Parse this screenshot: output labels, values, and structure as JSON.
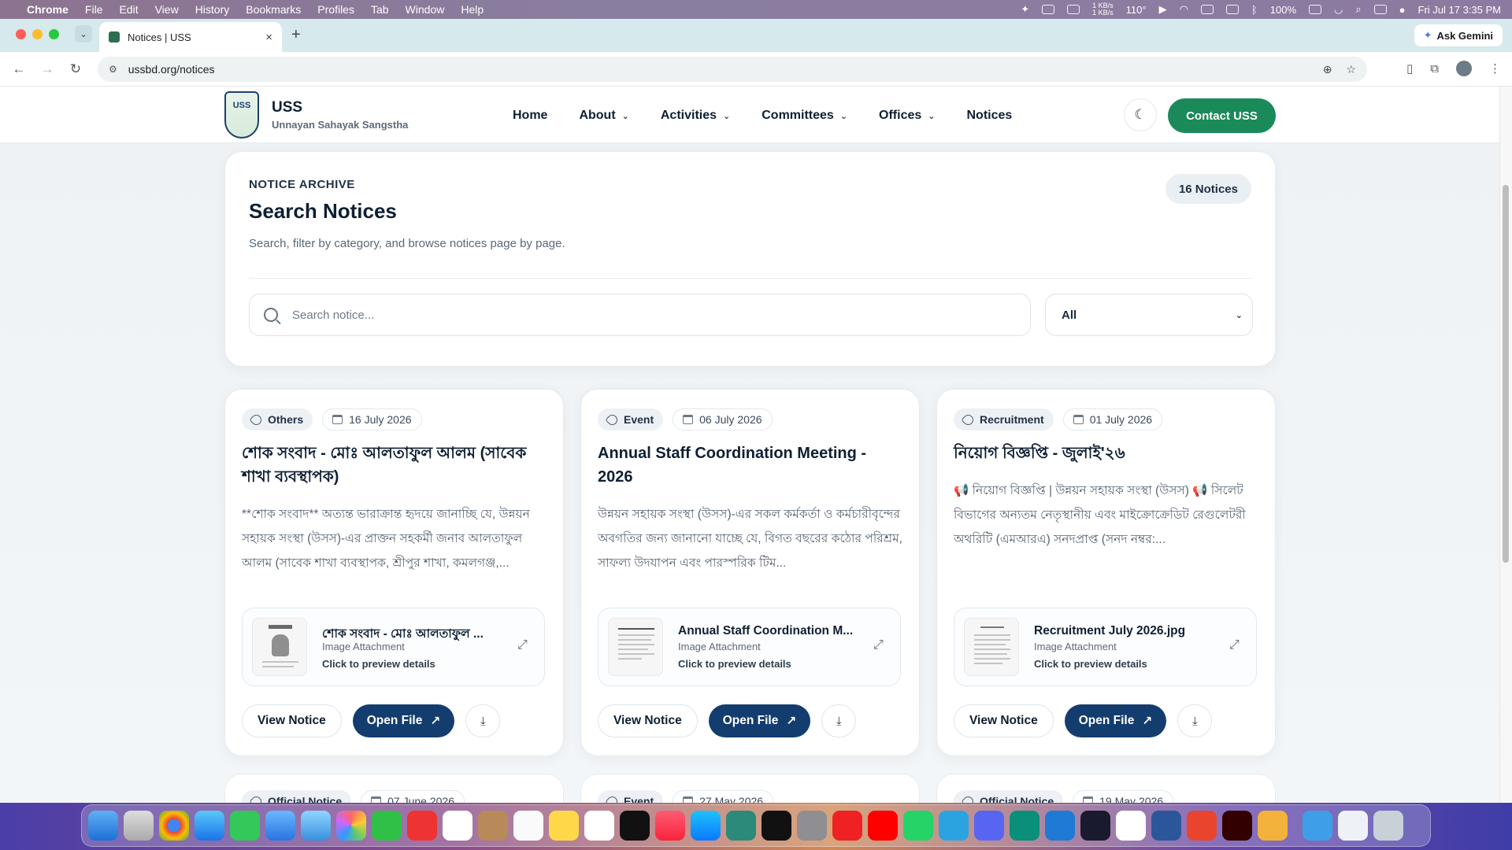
{
  "menubar": {
    "app": "Chrome",
    "items": [
      "File",
      "Edit",
      "View",
      "History",
      "Bookmarks",
      "Profiles",
      "Tab",
      "Window",
      "Help"
    ],
    "net_up": "1 KB/s",
    "net_down": "1 KB/s",
    "temp": "110°",
    "battery": "100%",
    "datetime": "Fri Jul 17  3:35 PM"
  },
  "browser": {
    "tab_title": "Notices | USS",
    "url": "ussbd.org/notices",
    "ask_gemini": "Ask Gemini"
  },
  "site": {
    "brand_name": "USS",
    "brand_sub": "Unnayan Sahayak Sangstha",
    "nav": [
      "Home",
      "About",
      "Activities",
      "Committees",
      "Offices",
      "Notices"
    ],
    "contact": "Contact USS"
  },
  "search": {
    "eyebrow": "NOTICE ARCHIVE",
    "title": "Search Notices",
    "description": "Search, filter by category, and browse notices page by page.",
    "count": "16 Notices",
    "placeholder": "Search notice...",
    "category": "All"
  },
  "notices": [
    {
      "category": "Others",
      "date": "16 July 2026",
      "title": "শোক সংবাদ - মোঃ আলতাফুল আলম (সাবেক শাখা ব্যবস্থাপক)",
      "excerpt": "**শোক সংবাদ** অত্যন্ত ভারাক্রান্ত হৃদয়ে জানাচ্ছি যে, উন্নয়ন সহায়ক সংস্থা (উসস)-এর প্রাক্তন সহকর্মী জনাব আলতাফুল আলম (সাবেক শাখা ব্যবস্থাপক, শ্রীপুর শাখা, কমলগঞ্জ,...",
      "attachment_name": "শোক সংবাদ - মোঃ আলতাফুল ...",
      "attachment_type": "Image Attachment",
      "attachment_hint": "Click to preview details"
    },
    {
      "category": "Event",
      "date": "06 July 2026",
      "title": "Annual Staff Coordination Meeting - 2026",
      "excerpt": "উন্নয়ন সহায়ক সংস্থা (উসস)-এর সকল কর্মকর্তা ও কর্মচারীবৃন্দের অবগতির জন্য জানানো যাচ্ছে যে, বিগত বছরের কঠোর পরিশ্রম, সাফল্য উদযাপন এবং পারস্পরিক টিম...",
      "attachment_name": "Annual Staff Coordination M...",
      "attachment_type": "Image Attachment",
      "attachment_hint": "Click to preview details"
    },
    {
      "category": "Recruitment",
      "date": "01 July 2026",
      "title": "নিয়োগ বিজ্ঞপ্তি - জুলাই'২৬",
      "excerpt": "📢 নিয়োগ বিজ্ঞপ্তি | উন্নয়ন সহায়ক সংস্থা (উসস) 📢 সিলেট বিভাগের অন্যতম নেতৃস্থানীয় এবং মাইক্রোক্রেডিট রেগুলেটরী অথরিটি (এমআরএ) সনদপ্রাপ্ত (সনদ নম্বর:...",
      "attachment_name": "Recruitment July 2026.jpg",
      "attachment_type": "Image Attachment",
      "attachment_hint": "Click to preview details"
    }
  ],
  "notices_next": [
    {
      "category": "Official Notice",
      "date": "07 June 2026"
    },
    {
      "category": "Event",
      "date": "27 May 2026"
    },
    {
      "category": "Official Notice",
      "date": "19 May 2026"
    }
  ],
  "actions": {
    "view": "View Notice",
    "open": "Open File"
  },
  "icons": {
    "expand": "expand-icon",
    "download": "download-icon",
    "external": "external-link-icon"
  },
  "colors": {
    "primary_navy": "#133d6e",
    "accent_green": "#1b8a5a"
  }
}
